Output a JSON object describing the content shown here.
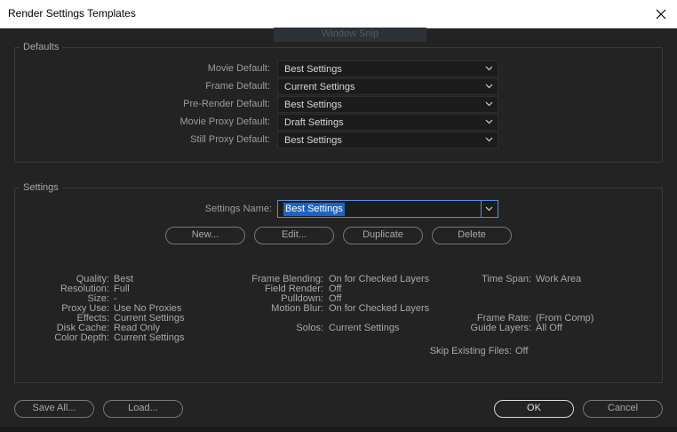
{
  "window": {
    "title": "Render Settings Templates",
    "background_text": "Window Snip"
  },
  "defaults": {
    "label": "Defaults",
    "rows": [
      {
        "label": "Movie Default:",
        "value": "Best Settings"
      },
      {
        "label": "Frame Default:",
        "value": "Current Settings"
      },
      {
        "label": "Pre-Render Default:",
        "value": "Best Settings"
      },
      {
        "label": "Movie Proxy Default:",
        "value": "Draft Settings"
      },
      {
        "label": "Still Proxy Default:",
        "value": "Best Settings"
      }
    ]
  },
  "settings": {
    "label": "Settings",
    "name_label": "Settings Name:",
    "name_value": "Best Settings",
    "buttons": {
      "new": "New...",
      "edit": "Edit...",
      "duplicate": "Duplicate",
      "delete": "Delete"
    },
    "col1": [
      {
        "k": "Quality:",
        "v": "Best"
      },
      {
        "k": "Resolution:",
        "v": "Full"
      },
      {
        "k": "Size:",
        "v": "-"
      },
      {
        "k": "Proxy Use:",
        "v": "Use No Proxies"
      },
      {
        "k": "Effects:",
        "v": "Current Settings"
      },
      {
        "k": "Disk Cache:",
        "v": "Read Only"
      },
      {
        "k": "Color Depth:",
        "v": "Current Settings"
      }
    ],
    "col2": [
      {
        "k": "Frame Blending:",
        "v": "On for Checked Layers"
      },
      {
        "k": "Field Render:",
        "v": "Off"
      },
      {
        "k": "Pulldown:",
        "v": "Off"
      },
      {
        "k": "Motion Blur:",
        "v": "On for Checked Layers"
      },
      {
        "k": "Solos:",
        "v": "Current Settings"
      }
    ],
    "col3": [
      {
        "k": "Time Span:",
        "v": "Work Area"
      },
      {
        "k": "Frame Rate:",
        "v": "(From Comp)"
      },
      {
        "k": "Guide Layers:",
        "v": "All Off"
      },
      {
        "k": "Skip Existing Files:",
        "v": "Off"
      }
    ]
  },
  "footer": {
    "save_all": "Save All...",
    "load": "Load...",
    "ok": "OK",
    "cancel": "Cancel"
  },
  "colors": {
    "background": "#232323",
    "selection": "#1e63c4",
    "accent_border": "#5a8fd6"
  }
}
